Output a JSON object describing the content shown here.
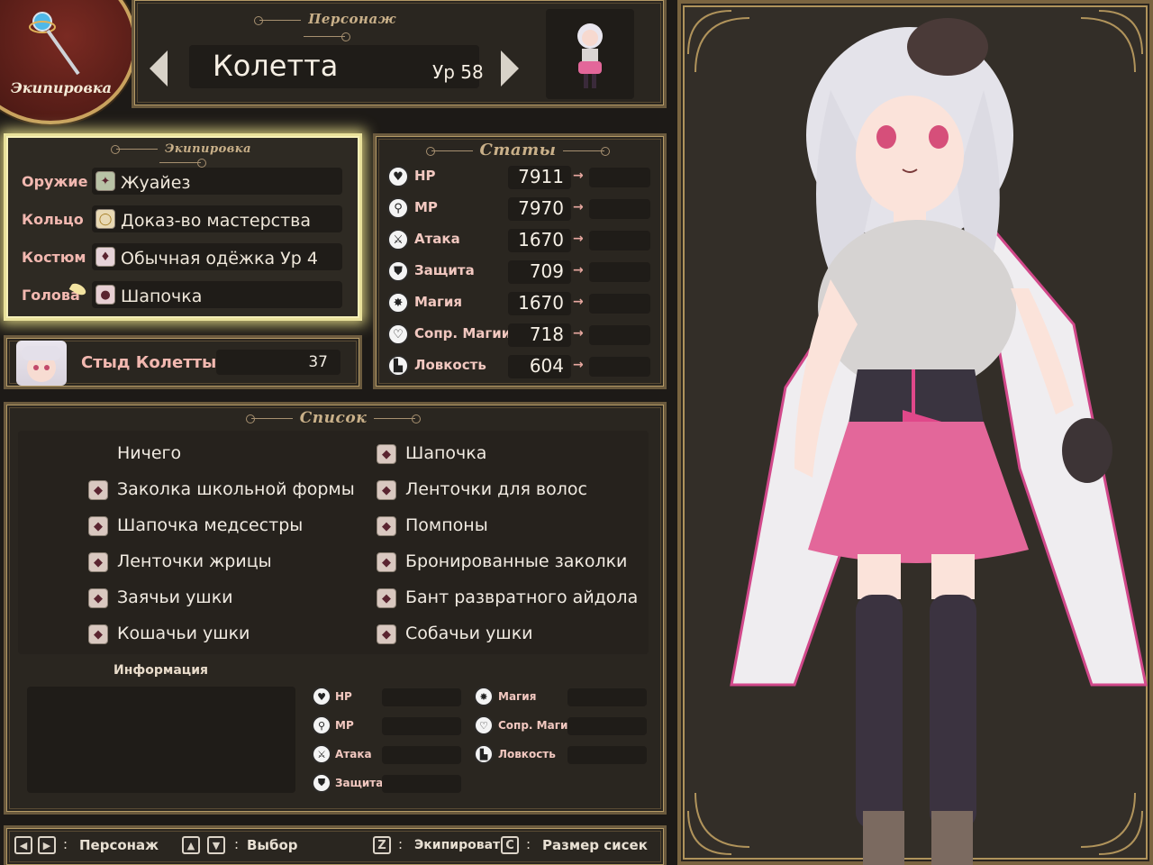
{
  "badge": {
    "title": "Экипировка"
  },
  "character": {
    "section_title": "Персонаж",
    "name": "Колетта",
    "level": "Ур 58"
  },
  "equipment": {
    "section_title": "Экипировка",
    "slots": [
      {
        "label": "Оружие",
        "item": "Жуайез",
        "icon": "weapon-icon"
      },
      {
        "label": "Кольцо",
        "item": "Доказ-во мастерства",
        "icon": "ring-icon"
      },
      {
        "label": "Костюм",
        "item": "Обычная одёжка Ур 4",
        "icon": "outfit-icon"
      },
      {
        "label": "Голова",
        "item": "Шапочка",
        "icon": "hat-icon"
      }
    ]
  },
  "shame": {
    "label": "Стыд Колетты",
    "value": "37"
  },
  "stats": {
    "section_title": "Статы",
    "rows": [
      {
        "label": "HP",
        "value": "7911",
        "icon": "heart-icon"
      },
      {
        "label": "MP",
        "value": "7970",
        "icon": "staff-icon"
      },
      {
        "label": "Атака",
        "value": "1670",
        "icon": "sword-icon"
      },
      {
        "label": "Защита",
        "value": "709",
        "icon": "shield-icon"
      },
      {
        "label": "Магия",
        "value": "1670",
        "icon": "magic-icon"
      },
      {
        "label": "Сопр. Магии",
        "value": "718",
        "icon": "magic-resist-icon"
      },
      {
        "label": "Ловкость",
        "value": "604",
        "icon": "boot-icon"
      }
    ],
    "arrow": "→"
  },
  "list": {
    "section_title": "Список",
    "left": [
      "Ничего",
      "Заколка школьной формы",
      "Шапочка медсестры",
      "Ленточки жрицы",
      "Заячьи ушки",
      "Кошачьи ушки"
    ],
    "right": [
      "Шапочка",
      "Ленточки для волос",
      "Помпоны",
      "Бронированные заколки",
      "Бант развратного айдола",
      "Собачьи ушки"
    ]
  },
  "info": {
    "title": "Информация",
    "stats_left": [
      "HP",
      "MP",
      "Атака",
      "Защита"
    ],
    "stats_right": [
      "Магия",
      "Сопр. Магии",
      "Ловкость"
    ]
  },
  "help": {
    "character": "Персонаж",
    "select": "Выбор",
    "equip_key": "Z",
    "equip": "Экипировать",
    "size_key": "C",
    "size": "Размер сисек"
  },
  "colors": {
    "panel": "#2a2620",
    "border": "#6b5a3e",
    "accent_pink": "#f2b8b0",
    "highlight": "#e9e19a"
  }
}
